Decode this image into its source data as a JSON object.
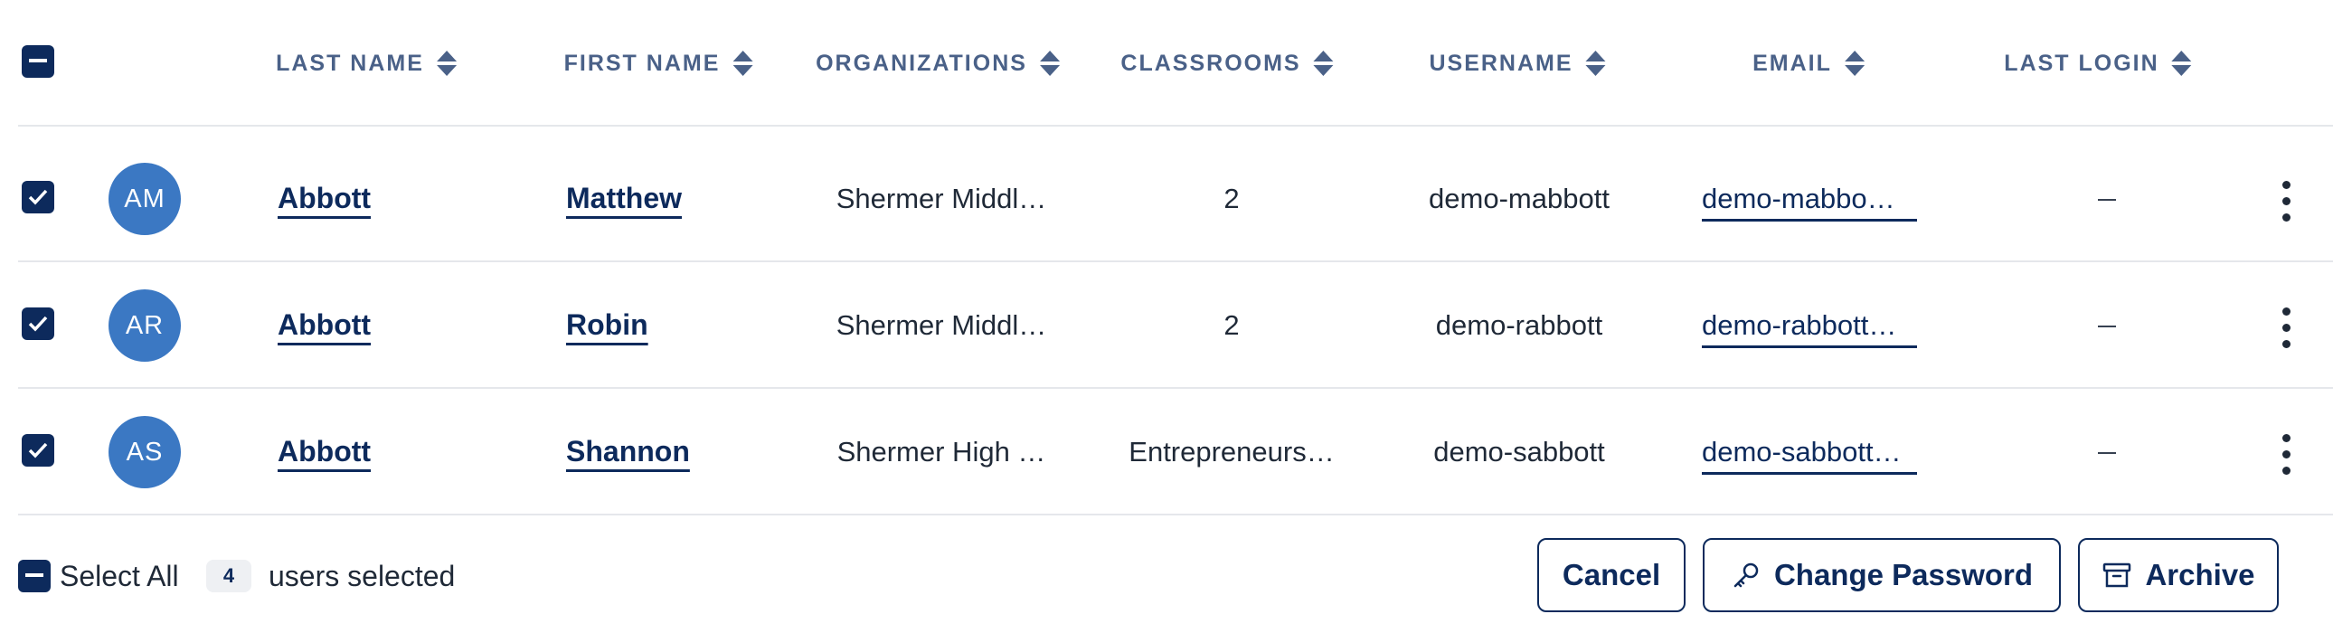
{
  "header": {
    "columns": [
      {
        "label": "LAST NAME"
      },
      {
        "label": "FIRST NAME"
      },
      {
        "label": "ORGANIZATIONS"
      },
      {
        "label": "CLASSROOMS"
      },
      {
        "label": "USERNAME"
      },
      {
        "label": "EMAIL"
      },
      {
        "label": "LAST LOGIN"
      }
    ]
  },
  "rows": [
    {
      "initials": "AM",
      "last_name": "Abbott",
      "first_name": "Matthew",
      "organization": "Shermer Middl…",
      "classrooms": "2",
      "username": "demo-mabbott",
      "email": "demo-mabbo…",
      "last_login": "–"
    },
    {
      "initials": "AR",
      "last_name": "Abbott",
      "first_name": "Robin",
      "organization": "Shermer Middl…",
      "classrooms": "2",
      "username": "demo-rabbott",
      "email": "demo-rabbott…",
      "last_login": "–"
    },
    {
      "initials": "AS",
      "last_name": "Abbott",
      "first_name": "Shannon",
      "organization": "Shermer High …",
      "classrooms": "Entrepreneurs…",
      "username": "demo-sabbott",
      "email": "demo-sabbott…",
      "last_login": "–"
    }
  ],
  "footer": {
    "select_all_label": "Select All",
    "selected_count": "4",
    "selected_suffix": "users selected",
    "cancel_label": "Cancel",
    "change_password_label": "Change Password",
    "archive_label": "Archive"
  },
  "icons": {
    "checkbox": "check-icon",
    "indeterminate": "minus-icon",
    "sort": "sort-icon",
    "more": "kebab-icon",
    "key": "key-icon",
    "archive": "archive-icon"
  },
  "colors": {
    "primary": "#0d2a5c",
    "header_text": "#4a6188",
    "avatar_bg": "#3b78c3",
    "divider": "#e5e7eb"
  }
}
